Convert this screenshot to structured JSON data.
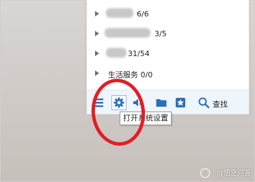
{
  "groups": [
    {
      "visible_text": "6/6"
    },
    {
      "visible_text": "3/5"
    },
    {
      "visible_text": "31/54"
    },
    {
      "visible_text": "生活服务 0/0"
    }
  ],
  "toolbar": {
    "menu_icon": "menu-icon",
    "settings_icon": "gear-icon",
    "sound_icon": "sound-icon",
    "folder_icon": "folder-icon",
    "star_icon": "star-icon",
    "search_icon": "search-icon",
    "find_label": "查找"
  },
  "tooltip": {
    "text": "打开系统设置"
  },
  "annotation": {
    "color": "#e41d25"
  },
  "watermark": {
    "text": "@悟空问答"
  }
}
